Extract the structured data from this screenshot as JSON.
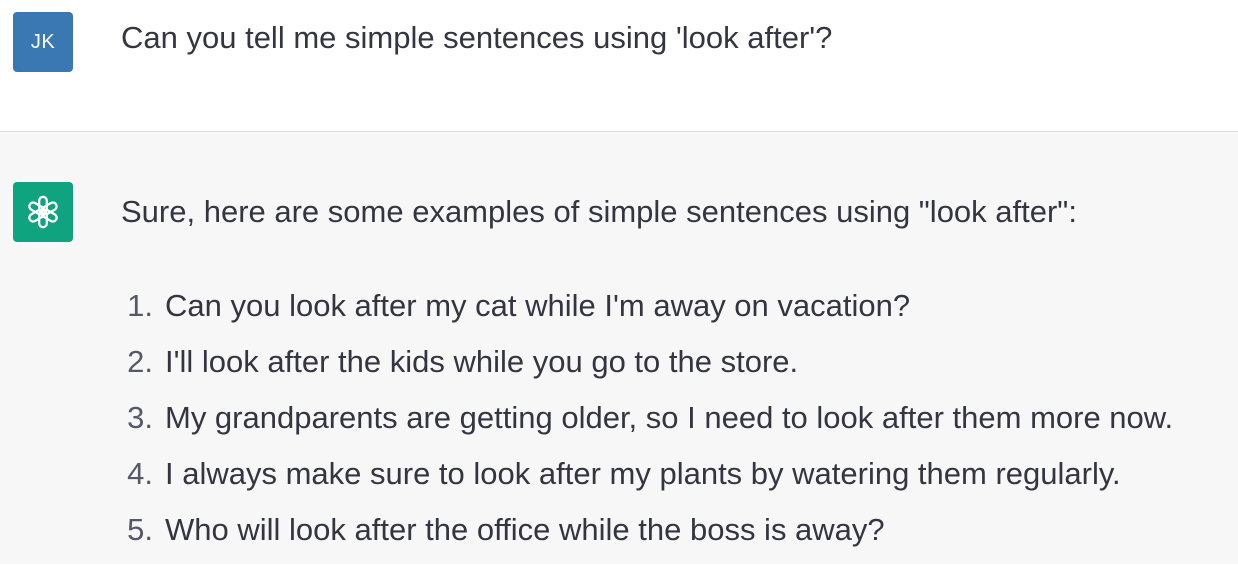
{
  "user": {
    "initials": "JK",
    "avatar_color": "#3a78b4",
    "message": "Can you tell me simple sentences using 'look after'?"
  },
  "assistant": {
    "avatar_icon": "openai-logo-icon",
    "avatar_color": "#10a37f",
    "intro": "Sure, here are some examples of simple sentences using \"look after\":",
    "sentences": [
      {
        "number": "1.",
        "text": "Can you look after my cat while I'm away on vacation?"
      },
      {
        "number": "2.",
        "text": "I'll look after the kids while you go to the store."
      },
      {
        "number": "3.",
        "text": "My grandparents are getting older, so I need to look after them more now."
      },
      {
        "number": "4.",
        "text": "I always make sure to look after my plants by watering them regularly."
      },
      {
        "number": "5.",
        "text": "Who will look after the office while the boss is away?"
      }
    ]
  }
}
